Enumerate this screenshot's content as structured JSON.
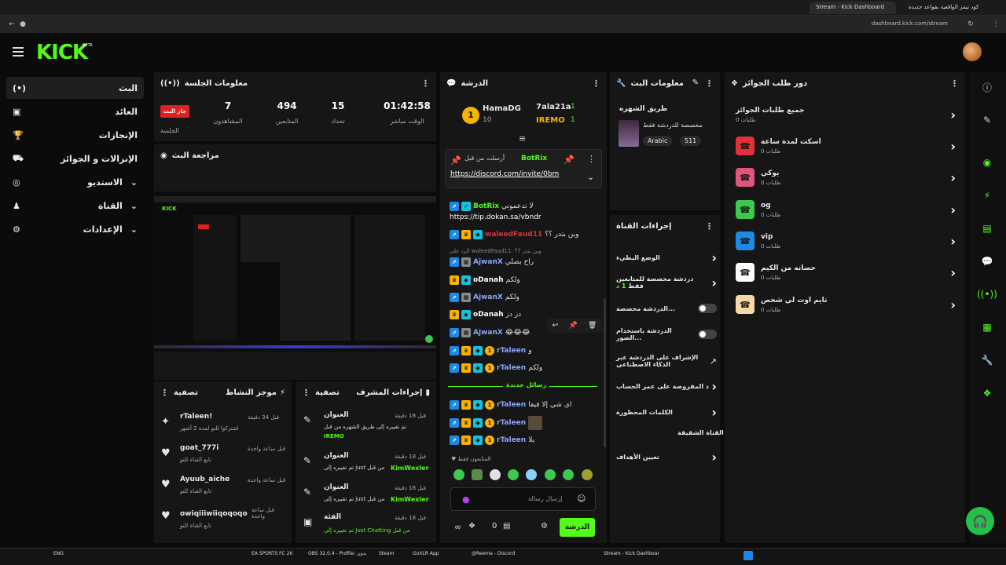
{
  "browser": {
    "tabs": [
      {
        "label": "Stream - Kick Dashboard",
        "active": true
      },
      {
        "label": "كود تيمز الواقعية بقواعد جديدة",
        "active": false
      }
    ],
    "url": "dashboard.kick.com/stream"
  },
  "app": {
    "logo": "KICK",
    "logo_badge": "BETA",
    "accent": "#53fc18"
  },
  "sidebar": {
    "items": [
      {
        "label": "البث",
        "icon": "(•)"
      },
      {
        "label": "العائد",
        "icon": "▣"
      },
      {
        "label": "الإنجازات",
        "icon": "🏆"
      },
      {
        "label": "الإنزالات و الجوائز",
        "icon": "⛟"
      },
      {
        "label": "الاستديو",
        "icon": "◎"
      },
      {
        "label": "القناة",
        "icon": "♟"
      },
      {
        "label": "الإعدادات",
        "icon": "⚙"
      }
    ]
  },
  "session": {
    "title": "معلومات الجلسة",
    "live_badge": "جار البث",
    "session_label": "الجلسة",
    "followers_value": "7",
    "followers_label": "المشاهدون",
    "viewers_value": "494",
    "viewers_label": "المتابعين",
    "subs_value": "15",
    "subs_label": "تحداد",
    "time_value": "01:42:58",
    "time_label": "الوقت مباشر"
  },
  "preview": {
    "title": "مراجعة البث"
  },
  "chat": {
    "title": "الدرشة",
    "leader_left_name": "HamaDG",
    "leader_left_value": "10",
    "leader_right_1": "7ala21a",
    "leader_right_1_value": "1",
    "leader_right_2": "IREMO",
    "leader_right_2_value": "1",
    "pinned_by": "أرسلت من قبل",
    "pinned_user": "BotRix",
    "pinned_link": "https://discord.com/invite/0bm",
    "messages": [
      {
        "user": "BotRix",
        "color": "#53fc18",
        "text": "لا تدعموني"
      },
      {
        "user": "",
        "color": "#fff",
        "text": "https://tip.dokan.sa/vbndr"
      },
      {
        "user": "waleedFaud11",
        "color": "#e0303a",
        "text": "وين بتدر ؟؟"
      },
      {
        "user": "",
        "color": "#888",
        "text": "الرد على waleedFaud11: وين بتدر ؟؟"
      },
      {
        "user": "AjwanX",
        "color": "#8aa6ff",
        "text": "راح يصلي"
      },
      {
        "user": "oDanah",
        "color": "#ffffff",
        "text": "ولكم"
      },
      {
        "user": "AjwanX",
        "color": "#8aa6ff",
        "text": "ولكم"
      },
      {
        "user": "oDanah",
        "color": "#ffffff",
        "text": "دز دز"
      },
      {
        "user": "AjwanX",
        "color": "#8aa6ff",
        "text": "😂😂😂"
      },
      {
        "user": "rTaleen",
        "color": "#8aa6ff",
        "text": "و"
      },
      {
        "user": "rTaleen",
        "color": "#8aa6ff",
        "text": "ولكم"
      }
    ],
    "new_messages": "رسائل جديدة",
    "messages_after": [
      {
        "user": "rTaleen",
        "text": "اي شي إلا فيفا"
      },
      {
        "user": "rTaleen",
        "text": ""
      },
      {
        "user": "rTaleen",
        "text": "يلا"
      }
    ],
    "followers_only": "المتابعون فقط",
    "input_placeholder": "إرسال رسالة",
    "send_label": "الدرشة",
    "counter": "0"
  },
  "stream_info": {
    "title": "معلومات البث",
    "category_label": "طريق الشهره",
    "desc": "مخصصة للدردشة فقط",
    "tag1": "Arabic",
    "tag2": "511"
  },
  "channel_actions": {
    "title": "إجراءات القناة",
    "items": [
      {
        "label": "الوضع البطيء",
        "type": "chevron"
      },
      {
        "label": "دردشة مخصصة للمتابعين فقط",
        "sub": "1 د",
        "type": "chevron"
      },
      {
        "label": "الدردشة مخصصة...",
        "type": "toggle"
      },
      {
        "label": "الدردشة باستخدام الصور...",
        "type": "toggle"
      },
      {
        "label": "الإشراف على الدردشة عبر الذكاء الاصطناعي",
        "type": "link"
      },
      {
        "label": "د المفروضة على عمر الحساب",
        "type": "chevron"
      },
      {
        "label": "الكلمات المحظورة",
        "type": "chevron"
      },
      {
        "label": "القناة الشقيقة",
        "type": "none"
      },
      {
        "label": "تعيين الأهداف",
        "type": "chevron"
      }
    ]
  },
  "rewards": {
    "title": "دور طلب الجوائز",
    "all_label": "جميع طلبات الجوائز",
    "all_sub": "0 طلبات",
    "items": [
      {
        "label": "اسكت لمدة ساعة",
        "sub": "0 طلبات",
        "color": "#e0303a",
        "icon": "☎"
      },
      {
        "label": "يوكي",
        "sub": "0 طلبات",
        "color": "#e0557a",
        "icon": "☎"
      },
      {
        "label": "og",
        "sub": "0 طلبات",
        "color": "#3ec84e",
        "icon": "☎"
      },
      {
        "label": "vip",
        "sub": "0 طلبات",
        "color": "#1e88e5",
        "icon": "☎"
      },
      {
        "label": "حصانه من الكيم",
        "sub": "0 طلبات",
        "color": "#ffffff",
        "icon": "☎"
      },
      {
        "label": "تايم اوت لي شخص",
        "sub": "0 طلبات",
        "color": "#f7d9a8",
        "icon": "☎"
      }
    ]
  },
  "activity": {
    "title": "موجز النشاط",
    "filter": "تصفية",
    "items": [
      {
        "user": "rTaleen!",
        "prefix": "اشترك",
        "time": "قبل 34 دقيقة",
        "sub": "اشتركوا للتو لمدة 2 أشهر"
      },
      {
        "user": "goat_777i",
        "prefix": "",
        "time": "قبل ساعة واحدة",
        "sub": "تابع القناة للتو"
      },
      {
        "user": "Ayuub_aiche",
        "prefix": "",
        "time": "قبل ساعة واحدة",
        "sub": "تابع القناة للتو"
      },
      {
        "user": "owiqiiiwiiqoqoqo",
        "prefix": "",
        "time": "قبل ساعة واحدة",
        "sub": "تابع القناة للتو"
      }
    ]
  },
  "mod_actions": {
    "title": "إجراءات المشرف",
    "filter": "تصفية",
    "items": [
      {
        "title": "العنوان",
        "time": "قبل 18 دقيقة",
        "text": "تم تغييره إلى طريق الشهره من قبل",
        "who": "IREMO"
      },
      {
        "title": "العنوان",
        "time": "قبل 18 دقيقة",
        "text": "تم تغييره إلى just من قبل",
        "who": "KimWexler"
      },
      {
        "title": "العنوان",
        "time": "قبل 18 دقيقة",
        "text": "تم تغييره إلى just من قبل",
        "who": "KimWexler"
      },
      {
        "title": "الفئة",
        "time": "قبل 18 دقيقة",
        "text": "تم تغييره إلى Just Chatting من قبل",
        "who": ""
      }
    ]
  },
  "taskbar": {
    "lang": "ENG",
    "items": [
      "EA SPORTS FC 26",
      "OBS 32.0.4 - Profile: بدون",
      "Steam",
      "GoXLR App",
      "@Reema - Discord",
      "Stream - Kick Dashboar"
    ]
  }
}
